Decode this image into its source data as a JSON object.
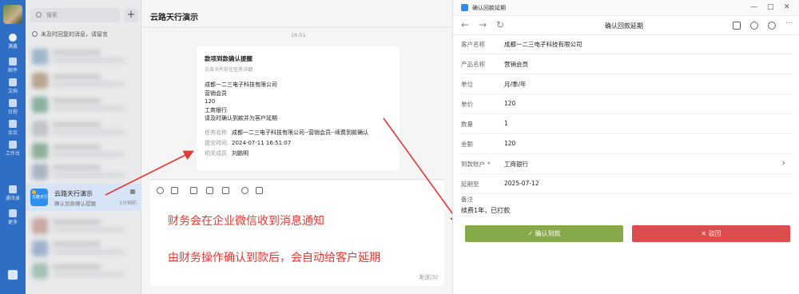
{
  "nav_rail": {
    "items": [
      {
        "label": "消息",
        "active": true
      },
      {
        "label": "邮件"
      },
      {
        "label": "文档"
      },
      {
        "label": "日程"
      },
      {
        "label": "会议"
      },
      {
        "label": "工作台"
      },
      {
        "label": "通讯录"
      },
      {
        "label": "更多"
      }
    ]
  },
  "conv_list": {
    "search_placeholder": "搜索",
    "plus": "+",
    "notice": "未及时回复的消息，请留言",
    "active": {
      "title": "云路天行演示",
      "subtitle": "确认到款确认提醒",
      "time": "1分钟前",
      "avatar_text": "云路天行"
    }
  },
  "chat": {
    "title": "云路天行演示",
    "time": "16:51",
    "card": {
      "title": "款项到款确认提醒",
      "subtitle": "点击卡片前往任务详细",
      "lines": [
        "成都一二三电子科技有限公司",
        "营销会员",
        "120",
        "工商银行",
        "请及时确认到款并为客户延期"
      ],
      "fields": [
        {
          "k": "任务名称",
          "v": "成都一二三电子科技有限公司--营销会员--续费到款确认"
        },
        {
          "k": "提交时间",
          "v": "2024-07-11 16:51:07"
        },
        {
          "k": "相关成员",
          "v": "刘鹏明"
        }
      ]
    },
    "send_label": "发送(S)",
    "annotations": [
      "财务会在企业微信收到消息通知",
      "由财务操作确认到款后，会自动给客户延期"
    ]
  },
  "detail": {
    "window_title": "确认回款延期",
    "page_title": "确认回款延期",
    "rows": [
      {
        "k": "客户名称",
        "v": "成都一二三电子科技有限公司"
      },
      {
        "k": "产品名称",
        "v": "营销会员"
      },
      {
        "k": "单位",
        "v": "月/季/年"
      },
      {
        "k": "单价",
        "v": "120"
      },
      {
        "k": "数量",
        "v": "1"
      },
      {
        "k": "金额",
        "v": "120"
      },
      {
        "k": "到款账户",
        "v": "工商银行",
        "required": "*",
        "chevron": "›"
      },
      {
        "k": "延期至",
        "v": "2025-07-12"
      }
    ],
    "note_label": "备注",
    "note_value": "续费1年，已打款",
    "confirm_label": "确认到款",
    "reject_label": "驳回",
    "window_controls": [
      "—",
      "□",
      "✕"
    ]
  },
  "colors": {
    "rail": "#2f6ec5",
    "confirm": "#86a94a",
    "reject": "#de4d4d",
    "annotation": "#e53935"
  }
}
